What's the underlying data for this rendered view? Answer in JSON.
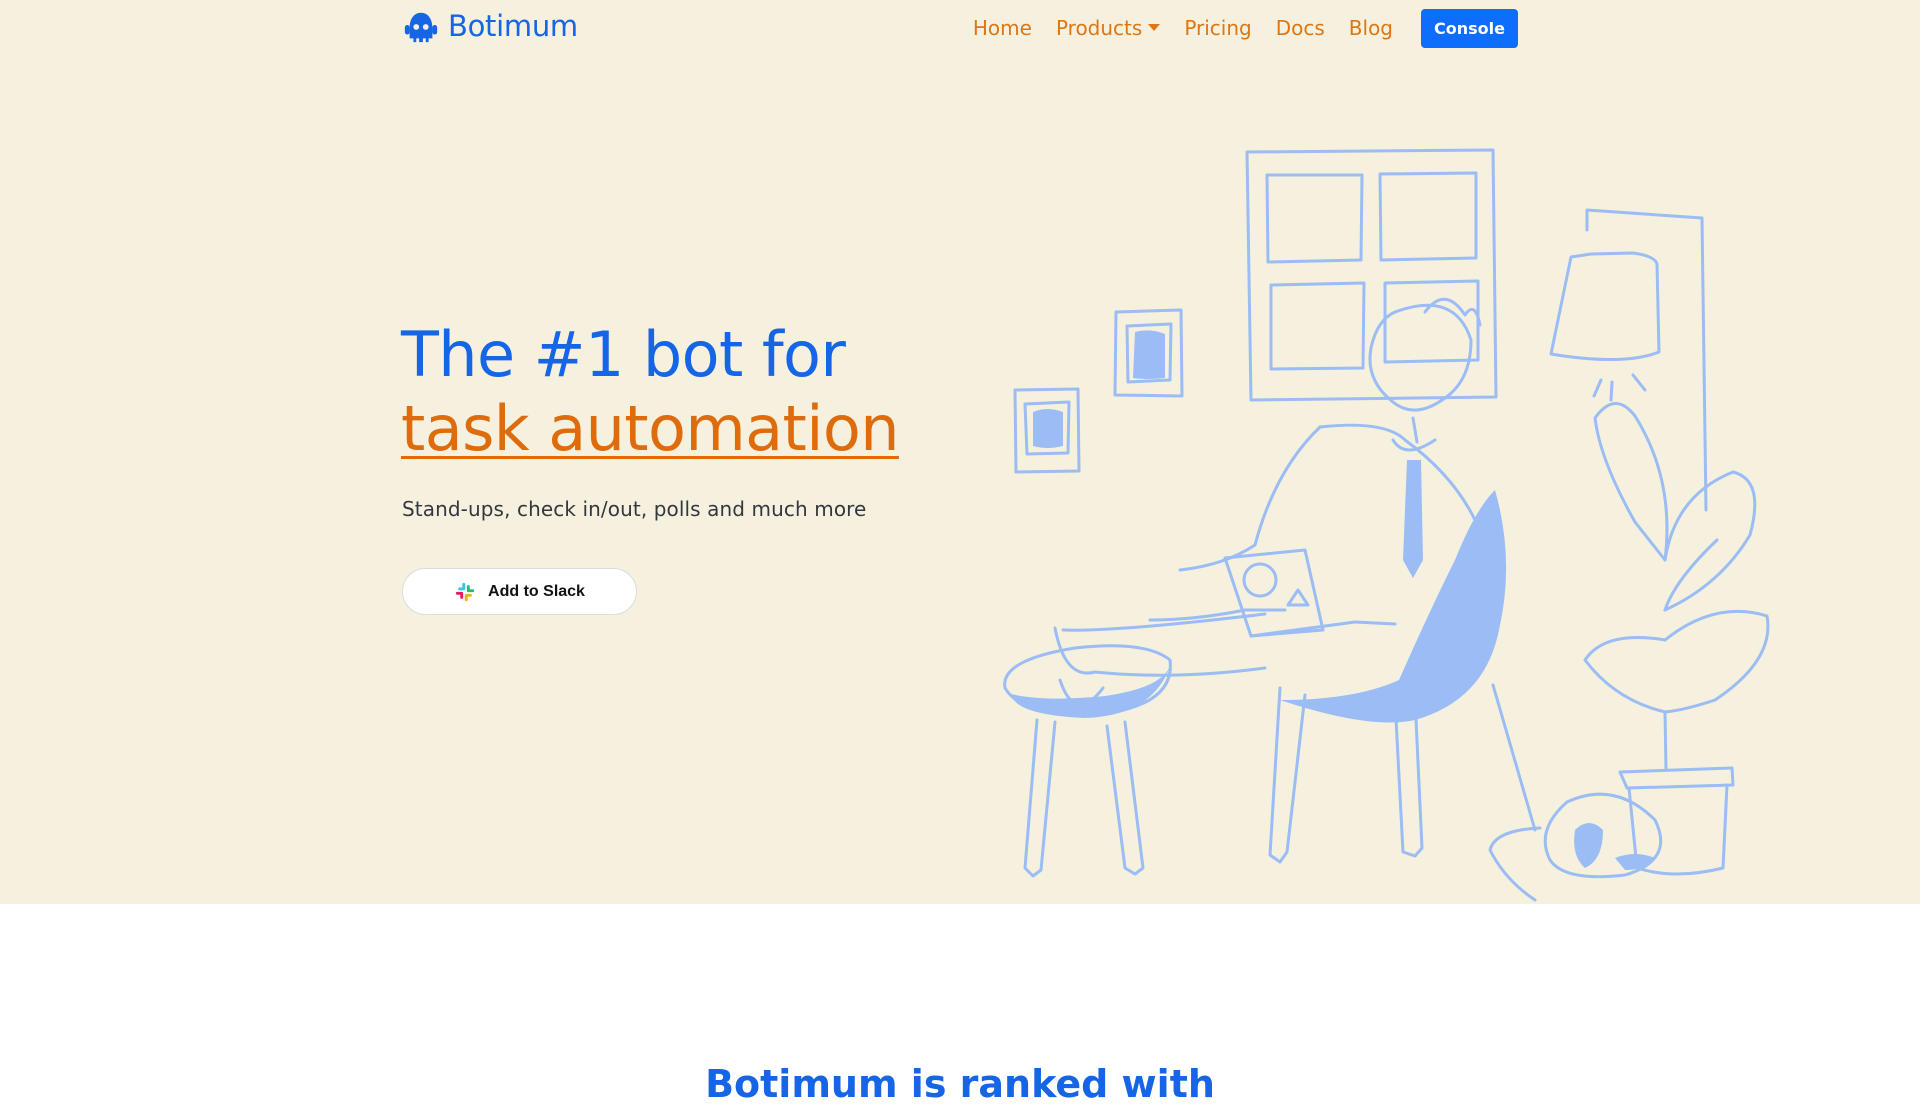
{
  "brand": {
    "name": "Botimum",
    "icon": "robot-logo-icon",
    "color": "#1565e6"
  },
  "nav": {
    "items": [
      {
        "label": "Home"
      },
      {
        "label": "Products",
        "has_dropdown": true
      },
      {
        "label": "Pricing"
      },
      {
        "label": "Docs"
      },
      {
        "label": "Blog"
      }
    ],
    "console_label": "Console",
    "link_color": "#de7612",
    "button_color": "#0d6efd"
  },
  "hero": {
    "title_line1": "The #1 bot for",
    "title_line2": "task automation",
    "subtitle": "Stand-ups, check in/out, polls and much more",
    "cta_label": "Add to Slack",
    "cta_icon": "slack-icon",
    "background": "#f5f1de",
    "illustration": "person-working-on-laptop-illustration"
  },
  "next_section": {
    "title": "Botimum is ranked with"
  }
}
